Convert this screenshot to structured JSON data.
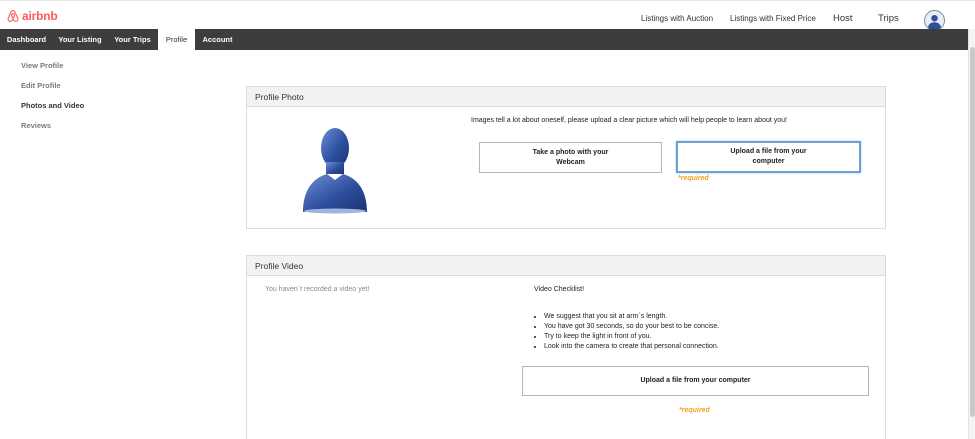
{
  "brand": {
    "name": "airbnb",
    "color": "#ff5a5f"
  },
  "topnav": {
    "auction": "Listings with Auction",
    "fixed_price": "Listings with Fixed Price",
    "host": "Host",
    "trips": "Trips"
  },
  "navbar": {
    "dashboard": "Dashboard",
    "your_listing": "Your Listing",
    "your_trips": "Your Trips",
    "profile": "Profile",
    "account": "Account"
  },
  "sidebar": {
    "view_profile": "View Profile",
    "edit_profile": "Edit Profile",
    "photos_and_video": "Photos and Video",
    "reviews": "Reviews"
  },
  "photo_panel": {
    "title": "Profile Photo",
    "intro": "Images tell a lot about oneself, please upload a clear picture which will help people to learn about you!",
    "webcam_button": "Take a photo with your Webcam",
    "upload_button": "Upload a file from your computer",
    "required": "*required"
  },
  "video_panel": {
    "title": "Profile Video",
    "empty_text": "You haven`t recorded a video yet!",
    "checklist_title": "Video Checklist!",
    "checklist": [
      "We suggest that you sit at arm`s length.",
      "You have got 30 seconds, so do your best to be concise.",
      "Try to keep the light in front of you.",
      "Look into the camera to create that personal connection."
    ],
    "upload_button": "Upload a file from your computer",
    "required": "*required"
  },
  "colors": {
    "nav_bg": "#3d3d3d",
    "required": "#f2a024",
    "focus_border": "#6ea0d8",
    "avatar_blue": "#2d4f9e"
  },
  "icons": {
    "logo": "airbnb-logo-icon",
    "user": "user-avatar-icon",
    "silhouette": "profile-silhouette-icon"
  }
}
